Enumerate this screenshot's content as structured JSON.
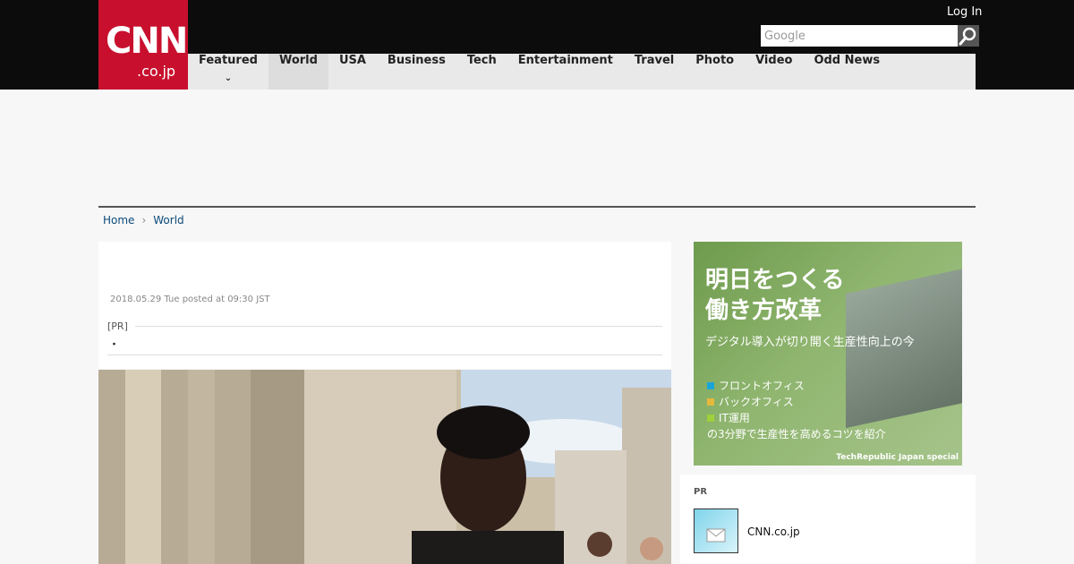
{
  "header": {
    "logo_main": "CNN",
    "logo_sub": ".co.jp",
    "login": "Log In",
    "search_placeholder": "Google"
  },
  "nav": {
    "items": [
      "Featured",
      "World",
      "USA",
      "Business",
      "Tech",
      "Entertainment",
      "Travel",
      "Photo",
      "Video",
      "Odd News"
    ],
    "active": "World"
  },
  "breadcrumb": {
    "home": "Home",
    "current": "World"
  },
  "article": {
    "date": "2018.05.29 Tue posted at 09:30 JST",
    "pr_label": "[PR]",
    "pr_text": "・"
  },
  "ad": {
    "line1": "明日をつくる",
    "line2": "働き方改革",
    "subtitle": "デジタル導入が切り開く生産性向上の今",
    "items": [
      "フロントオフィス",
      "バックオフィス",
      "IT運用"
    ],
    "item_colors": [
      "#1aa5d8",
      "#e5b93b",
      "#9ed13a"
    ],
    "tagline": "の3分野で生産性を高めるコツを紹介",
    "brand": "TechRepublic Japan special"
  },
  "pr_box": {
    "label": "PR",
    "item": "CNN.co.jp"
  },
  "colors": {
    "brand": "#c8102e",
    "topbar": "#0c0c0c",
    "nav_bg": "#e9e9e9",
    "link": "#0a4a7a"
  }
}
